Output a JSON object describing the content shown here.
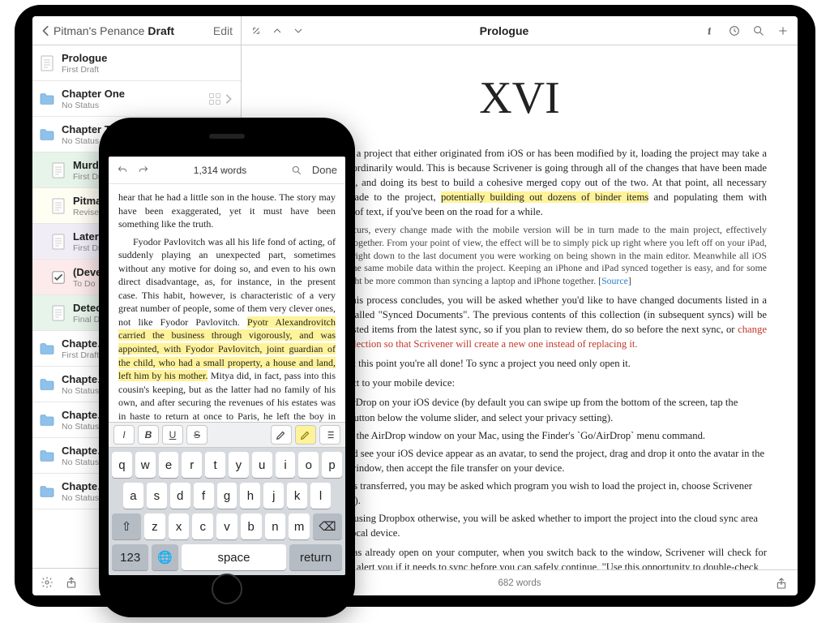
{
  "ipad": {
    "sidebar": {
      "back_label": "Pitman's Penance",
      "current_label": "Draft",
      "edit_label": "Edit",
      "items": [
        {
          "name": "Prologue",
          "status": "First Draft",
          "icon": "document",
          "tint": "",
          "indent": false,
          "expandable": false
        },
        {
          "name": "Chapter One",
          "status": "No Status",
          "icon": "folder",
          "tint": "",
          "indent": false,
          "expandable": true
        },
        {
          "name": "Chapter Two",
          "status": "No Status",
          "icon": "folder",
          "tint": "",
          "indent": false,
          "expandable": true
        },
        {
          "name": "Murder…",
          "status": "First Draft",
          "icon": "document",
          "tint": "green",
          "indent": true,
          "expandable": false
        },
        {
          "name": "Pitman…",
          "status": "Revised",
          "icon": "document",
          "tint": "yellow",
          "indent": true,
          "expandable": false
        },
        {
          "name": "Later t…",
          "status": "First Draft",
          "icon": "document",
          "tint": "purple",
          "indent": true,
          "expandable": false
        },
        {
          "name": "(Devel…",
          "status": "To Do",
          "icon": "checkbox",
          "tint": "red",
          "indent": true,
          "expandable": false
        },
        {
          "name": "Detect…",
          "status": "Final Draft",
          "icon": "document",
          "tint": "green",
          "indent": true,
          "expandable": false
        },
        {
          "name": "Chapte…",
          "status": "First Draft",
          "icon": "folder",
          "tint": "",
          "indent": false,
          "expandable": true
        },
        {
          "name": "Chapte…",
          "status": "No Status",
          "icon": "folder",
          "tint": "",
          "indent": false,
          "expandable": true
        },
        {
          "name": "Chapte…",
          "status": "No Status",
          "icon": "folder",
          "tint": "",
          "indent": false,
          "expandable": true
        },
        {
          "name": "Chapte…",
          "status": "No Status",
          "icon": "folder",
          "tint": "",
          "indent": false,
          "expandable": true
        },
        {
          "name": "Chapte…",
          "status": "No Status",
          "icon": "folder",
          "tint": "",
          "indent": false,
          "expandable": true
        }
      ]
    },
    "main": {
      "title": "Prologue",
      "heading": "XVI",
      "p1a": "When you open a project that either originated from iOS or has been modified by it, loading the project may take a little longer than it ordinarily would. This is because Scrivener is going through all of the changes that have been made \"in both directions\", and doing its best to build a cohesive merged copy out of the two. At that point, all necessary changes will be made to the project, ",
      "p1_hl": "potentially building out dozens of binder items",
      "p1b": " and populating them with thousands of words of text, if you've been on the road for a while.",
      "note1": "When sync occurs, every change made with the mobile version will be in turn made to the main project, effectively merging them together. From your point of view, the effect will be to simply pick up right where you left off on your iPad, moments ago, right down to the last document you were working on being shown in the main editor. Meanwhile all iOS devices share the same mobile data within the project. Keeping an iPhone and iPad synced together is easy, and for some people that might be more common than syncing a laptop and iPhone together. [",
      "note1_link": "Source",
      "note1_end": "]",
      "p2a": "The first time this process concludes, you will be asked whether you'd like to have changed documents listed in a yellow Collection called \"Synced Documents\". The previous contents of this collection (in subsequent syncs) will be replaced with the listed items from the latest sync, so if you plan to review them, do so before the next sync, or ",
      "p2_red": "change the name of this collection so that Scrivener will create a new one instead of replacing it.",
      "p3": "In most cases, at this point you're all done! To sync a project you need only open it.",
      "p4": "To copy a project to your mobile device:",
      "list": [
        "Enable AirDrop on your iOS device (by default you can swipe up from the bottom of the screen, tap the AirDrop button below the volume slider, and select your privacy setting).",
        "Now open the AirDrop window on your Mac, using the Finder's `Go/AirDrop` menu command.",
        "You should see your iOS device appear as an avatar, to send the project, drag and drop it onto the avatar in the AirDrop window, then accept the file transfer on your device.",
        "Once it has transferred, you may be asked which program you wish to load the project in, choose Scrivener (naturally!).",
        "If you are using Dropbox otherwise, you will be asked whether to import the project into the cloud sync area or to the local device."
      ],
      "p5": "If the project was already open on your computer, when you switch back to the  window, Scrivener will check for mobile changes and alert you if it needs to sync before you can safely continue. \"Use this opportunity to double-check",
      "footer_wc": "682 words"
    }
  },
  "iphone": {
    "toolbar": {
      "wordcount": "1,314 words",
      "done": "Done"
    },
    "p1": "hear that he had a little son in the house. The story may have been exaggerated, yet it must have been something like the truth.",
    "p2a": "Fyodor Pavlovitch was all his life fond of acting, of suddenly playing an unexpected part, sometimes without any motive for doing so, and even to his own direct disadvantage, as, for instance, in the present case. This habit, however, is characteristic of a very great number of people, some of them very clever ones, not like Fyodor Pavlovitch. ",
    "p2_hl": "Pyotr Alexandrovitch carried the business through vigorously, and was appointed, with Fyodor Pavlovitch, joint guardian of the child, who had a small property, a house and land, left him by his mother.",
    "p2b": " Mitya did, in fact, pass into this cousin's keeping, but as the latter had no family of his own, and after securing the revenues of his estates was in haste to return at once to Paris, he left the boy in charge of one of his cousins, a lady living in Moscow. It came to pass that, settling permanently in Paris he, too, forgot the child, especially when the Revolution of February broke out, making an impression on his mind that he",
    "format_buttons": [
      "italic",
      "bold-italic",
      "underline",
      "strike",
      "pen",
      "highlight",
      "list"
    ],
    "keyboard": {
      "row1": [
        "q",
        "w",
        "e",
        "r",
        "t",
        "y",
        "u",
        "i",
        "o",
        "p"
      ],
      "row2": [
        "a",
        "s",
        "d",
        "f",
        "g",
        "h",
        "j",
        "k",
        "l"
      ],
      "row3_shift": "⇧",
      "row3": [
        "z",
        "x",
        "c",
        "v",
        "b",
        "n",
        "m"
      ],
      "row3_del": "⌫",
      "row4": {
        "num": "123",
        "globe": "🌐",
        "space": "space",
        "return": "return"
      }
    }
  }
}
